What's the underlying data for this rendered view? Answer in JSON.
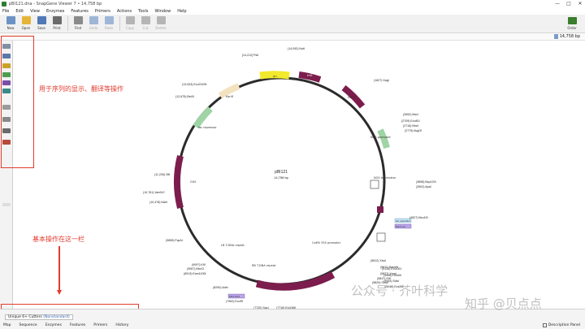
{
  "window": {
    "title": "pBI121.dna - SnapGene Viewer 7 • 14,758 bp",
    "minimize": "—",
    "maximize": "□",
    "close": "✕"
  },
  "menu": [
    "File",
    "Edit",
    "View",
    "Enzymes",
    "Features",
    "Primers",
    "Actions",
    "Tools",
    "Window",
    "Help"
  ],
  "toolbar": {
    "buttons": [
      {
        "label": "New",
        "color": "#6d93c4",
        "disabled": false
      },
      {
        "label": "Open",
        "color": "#e5b53a",
        "disabled": false
      },
      {
        "label": "Save",
        "color": "#5079b5",
        "disabled": false
      },
      {
        "label": "Print",
        "color": "#6b6b6b",
        "disabled": false
      },
      {
        "label": "Find",
        "color": "#8a8a8a",
        "disabled": false
      },
      {
        "label": "Undo",
        "color": "#9fb6d6",
        "disabled": true
      },
      {
        "label": "Redo",
        "color": "#9fb6d6",
        "disabled": true
      },
      {
        "label": "Copy",
        "color": "#b5b5b5",
        "disabled": true
      },
      {
        "label": "Cut",
        "color": "#b5b5b5",
        "disabled": true
      },
      {
        "label": "Delete",
        "color": "#b5b5b5",
        "disabled": true
      }
    ],
    "order_label": "Order"
  },
  "status": {
    "length": "14,758 bp"
  },
  "sidebar_icons": [
    {
      "name": "map-view-icon",
      "color": "#7f8fa6"
    },
    {
      "name": "sequence-view-icon",
      "color": "#5a79a8"
    },
    {
      "name": "enzymes-icon",
      "color": "#c9a227"
    },
    {
      "name": "features-icon",
      "color": "#4f9d4f"
    },
    {
      "name": "primers-icon",
      "color": "#7b4fa8"
    },
    {
      "name": "orfs-icon",
      "color": "#3a8a8a"
    },
    {
      "name": "translation-icon",
      "color": "#9a9a9a"
    },
    {
      "name": "gc-icon",
      "color": "#888888"
    },
    {
      "name": "zoom-icon",
      "color": "#6a6a6a"
    },
    {
      "name": "cut-sites-icon",
      "color": "#b84a3a"
    }
  ],
  "annotations": {
    "sidebar_note": "用于序列的显示、翻译等操作",
    "bottom_note": "基本操作在这一栏"
  },
  "map": {
    "name": "pBI121",
    "length": "14,758 bp",
    "labels": [
      {
        "text": "NotI",
        "pos": "(14,092)"
      },
      {
        "text": "PstI",
        "pos": "[14,212]"
      },
      {
        "text": "EcoO109I",
        "pos": "(13,003)"
      },
      {
        "text": "BstXI",
        "pos": "(12,675)"
      },
      {
        "text": "XagI",
        "pos": "(1627)"
      },
      {
        "text": "MscI",
        "pos": "(2652)"
      },
      {
        "text": "Eco81I",
        "pos": "(2709)"
      },
      {
        "text": "NheI",
        "pos": "(2716)"
      },
      {
        "text": "AvgOI",
        "pos": "(2775)"
      },
      {
        "text": "SfiI",
        "pos": "(11,226)"
      },
      {
        "text": "Van91I*",
        "pos": "(10,761)"
      },
      {
        "text": "NdeI",
        "pos": "(10,478)"
      },
      {
        "text": "Bsp120I",
        "pos": "(3898)"
      },
      {
        "text": "ApaI",
        "pos": "(3902)"
      },
      {
        "text": "Bsu15I",
        "pos": "(4827)"
      },
      {
        "text": "FspAI",
        "pos": "(9855)"
      },
      {
        "text": "KflI",
        "pos": "(9097)"
      },
      {
        "text": "BbvCI",
        "pos": "(9067)"
      },
      {
        "text": "Eam1105I",
        "pos": "(8913)"
      },
      {
        "text": "AdeI",
        "pos": "(8290)"
      },
      {
        "text": "EcoRI",
        "pos": "(7962)"
      },
      {
        "text": "SacI",
        "pos": "(7720)"
      },
      {
        "text": "Ecl136II",
        "pos": "(7718)"
      },
      {
        "text": "XbaI",
        "pos": "(5812)"
      },
      {
        "text": "BamHI",
        "pos": "(5811)"
      },
      {
        "text": "Ecl1051",
        "pos": "(5125)"
      },
      {
        "text": "HindIII",
        "pos": "(4906)"
      },
      {
        "text": "SdaI",
        "pos": "(4944)"
      },
      {
        "text": "Ecs31I",
        "pos": "(5048)"
      },
      {
        "text": "SmaI",
        "pos": "(5829)"
      },
      {
        "text": "SrfI",
        "pos": "(5847)"
      },
      {
        "text": "XmaI",
        "pos": "(5827)"
      }
    ],
    "features": {
      "orir": "oriV",
      "trfa": "trfA",
      "kanr": "KanR",
      "nptii": "NPTII",
      "nos_promoter": "NOS promoter",
      "nos_terminator": "NOS terminator",
      "lb": "LB T-DNA repeat",
      "rb": "RB T-DNA repeat",
      "camv": "CaMV 35S promoter",
      "gus": "GUS",
      "lac": "lac repressor",
      "m13fwd": "M13 fwd",
      "m13rev": "M13 rev",
      "sv40": "SV40",
      "ori": "ori",
      "lac_o": "lac operator"
    }
  },
  "bottom": {
    "view_tab_prefix": "Unique 6+ Cutters",
    "view_tab_hl": "(Nonstandard)",
    "tabs": [
      "Map",
      "Sequence",
      "Enzymes",
      "Features",
      "Primers",
      "History"
    ],
    "description_panel": "Description Panel"
  },
  "watermark": {
    "left": "公众号 · 芥叶科学",
    "right": "知乎 @贝点点"
  }
}
